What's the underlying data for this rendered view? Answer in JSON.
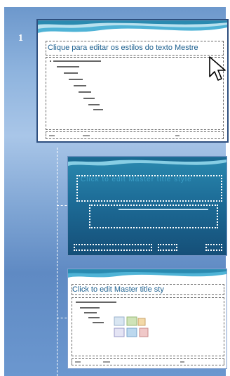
{
  "slide_panel": {
    "slide_number": "1",
    "master": {
      "title": "Clique para editar os estilos do texto Mestre"
    },
    "layout_title": {
      "title": "Click to edit Master title style"
    },
    "layout_content": {
      "title": "Click to edit Master title sty"
    }
  }
}
